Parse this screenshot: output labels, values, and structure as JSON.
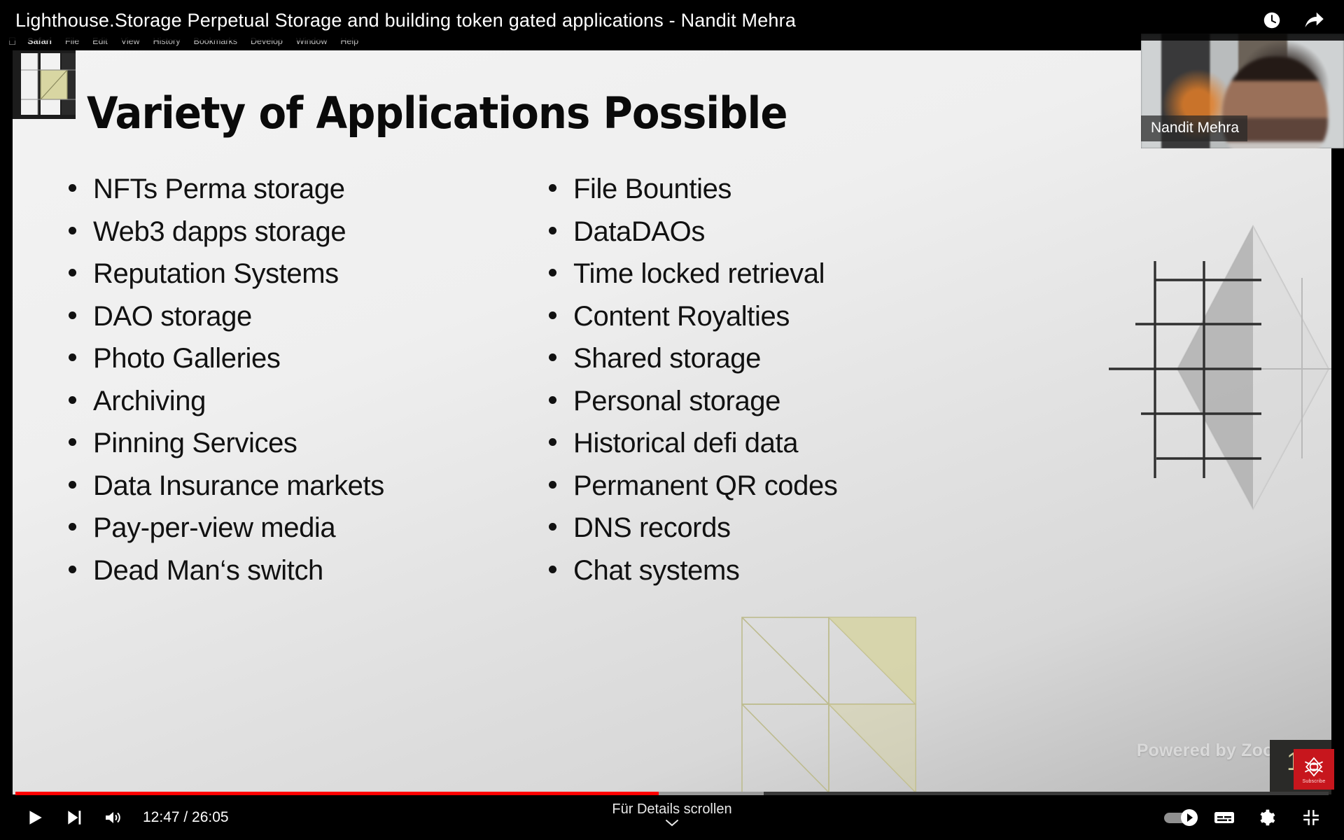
{
  "player": {
    "video_title": "Lighthouse.Storage Perpetual Storage and building token gated applications - Nandit Mehra",
    "watch_later_icon": "clock-icon",
    "share_icon": "share-arrow-icon",
    "play_icon": "play-icon",
    "next_icon": "next-track-icon",
    "volume_icon": "volume-icon",
    "time_display": "12:47 / 26:05",
    "current_time": "12:47",
    "duration": "26:05",
    "progress_percent": 49,
    "buffer_percent": 57,
    "scroll_hint": "Für Details scrollen",
    "scroll_hint_icon": "chevron-down-icon",
    "autoplay_icon": "autoplay-toggle-icon",
    "subtitles_icon": "subtitles-cc-icon",
    "settings_icon": "gear-icon",
    "fullscreen_icon": "exit-fullscreen-icon",
    "accent_color": "#ff0000"
  },
  "mac_menubar": {
    "apple_icon": "apple-logo-icon",
    "items": [
      {
        "label": "Safari",
        "bold": true
      },
      {
        "label": "File",
        "bold": false
      },
      {
        "label": "Edit",
        "bold": false
      },
      {
        "label": "View",
        "bold": false
      },
      {
        "label": "History",
        "bold": false
      },
      {
        "label": "Bookmarks",
        "bold": false
      },
      {
        "label": "Develop",
        "bold": false
      },
      {
        "label": "Window",
        "bold": false
      },
      {
        "label": "Help",
        "bold": false
      }
    ]
  },
  "webcam": {
    "participant_name": "Nandit Mehra"
  },
  "subscribe_badge": {
    "label": "Subscribe",
    "icon": "lighthouse-logo-icon",
    "color": "#c7161d"
  },
  "slide": {
    "title": "Variety of Applications Possible",
    "slide_number": "15",
    "watermark": "Powered by Zoom",
    "accent_khaki": "#cfcb9a",
    "columns": [
      {
        "bullets": [
          "NFTs Perma storage",
          "Web3 dapps storage",
          "Reputation Systems",
          "DAO storage",
          "Photo Galleries",
          "Archiving",
          "Pinning Services",
          "Data Insurance markets",
          "Pay-per-view media",
          "Dead Man‘s switch"
        ]
      },
      {
        "bullets": [
          "File Bounties",
          "DataDAOs",
          "Time locked retrieval",
          "Content Royalties",
          "Shared storage",
          "Personal storage",
          "Historical defi data",
          "Permanent QR codes",
          "DNS records",
          "Chat systems"
        ]
      }
    ]
  }
}
